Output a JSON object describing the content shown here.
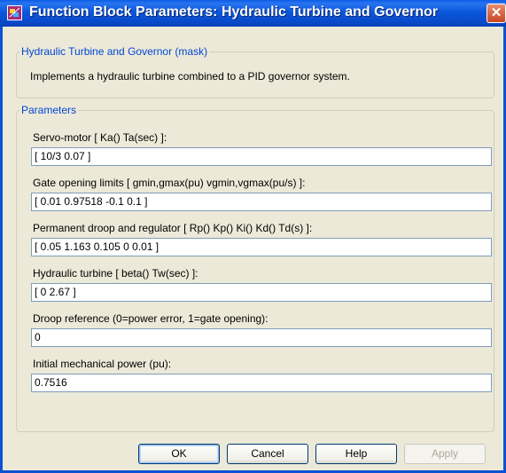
{
  "window": {
    "title": "Function Block Parameters: Hydraulic Turbine and Governor",
    "close_glyph": "✕"
  },
  "mask": {
    "group_label": "Hydraulic Turbine and Governor (mask)",
    "description": "Implements a hydraulic turbine combined to a PID governor system."
  },
  "parameters": {
    "group_label": "Parameters",
    "fields": [
      {
        "label": "Servo-motor [ Ka()  Ta(sec) ]:",
        "value": "[ 10/3  0.07 ]"
      },
      {
        "label": "Gate opening limits [ gmin,gmax(pu)     vgmin,vgmax(pu/s) ]:",
        "value": "[  0.01  0.97518  -0.1  0.1 ]"
      },
      {
        "label": "Permanent droop and regulator  [ Rp() Kp() Ki() Kd() Td(s) ]:",
        "value": "[  0.05  1.163  0.105  0  0.01  ]"
      },
      {
        "label": "Hydraulic turbine [ beta()  Tw(sec) ]:",
        "value": "[  0  2.67  ]"
      },
      {
        "label": "Droop reference (0=power error, 1=gate opening):",
        "value": "0"
      },
      {
        "label": "Initial mechanical power (pu):",
        "value": "0.7516"
      }
    ]
  },
  "buttons": {
    "ok": "OK",
    "cancel": "Cancel",
    "help": "Help",
    "apply": "Apply"
  },
  "colors": {
    "titlebar": "#0b57dc",
    "group_legend": "#0046d5",
    "dialog_bg": "#ece9d8"
  }
}
